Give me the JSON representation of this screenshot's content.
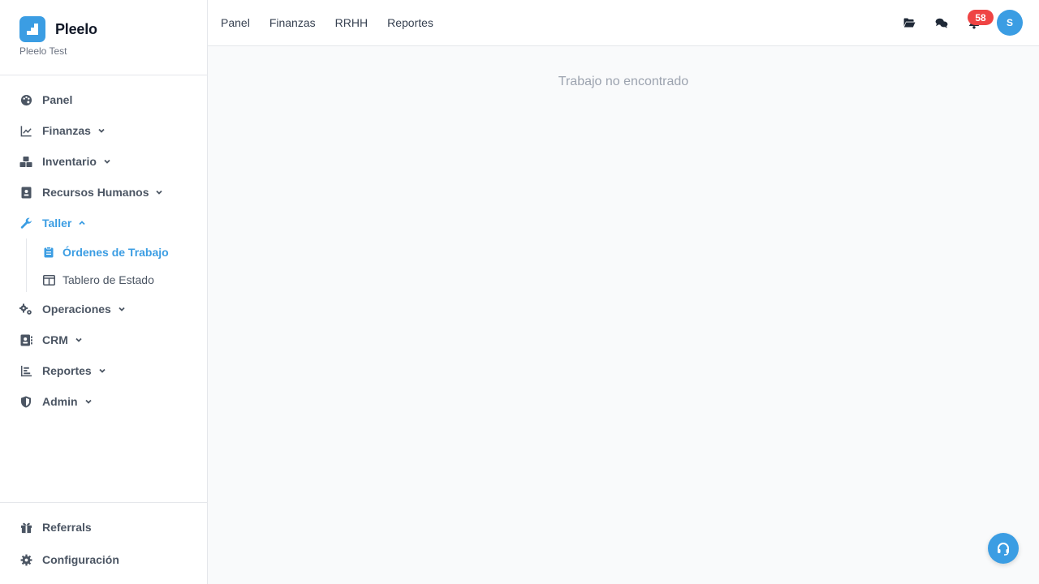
{
  "brand": {
    "name": "Pleelo",
    "subtitle": "Pleelo Test",
    "color": "#3b9de3"
  },
  "sidebar": {
    "items": [
      {
        "label": "Panel",
        "icon": "palette-icon"
      },
      {
        "label": "Finanzas",
        "icon": "chart-line-icon",
        "expandable": true
      },
      {
        "label": "Inventario",
        "icon": "boxes-icon",
        "expandable": true
      },
      {
        "label": "Recursos Humanos",
        "icon": "id-badge-icon",
        "expandable": true
      },
      {
        "label": "Taller",
        "icon": "wrench-icon",
        "expandable": true,
        "expanded": true,
        "active": true
      },
      {
        "label": "Operaciones",
        "icon": "cogs-icon",
        "expandable": true
      },
      {
        "label": "CRM",
        "icon": "address-book-icon",
        "expandable": true
      },
      {
        "label": "Reportes",
        "icon": "chart-bar-icon",
        "expandable": true
      },
      {
        "label": "Admin",
        "icon": "shield-icon",
        "expandable": true
      }
    ],
    "taller_subitems": [
      {
        "label": "Órdenes de Trabajo",
        "icon": "clipboard-icon",
        "active": true
      },
      {
        "label": "Tablero de Estado",
        "icon": "columns-icon"
      }
    ],
    "footer": [
      {
        "label": "Referrals",
        "icon": "gift-icon"
      },
      {
        "label": "Configuración",
        "icon": "gear-icon"
      }
    ]
  },
  "topbar": {
    "nav": [
      "Panel",
      "Finanzas",
      "RRHH",
      "Reportes"
    ],
    "notification_count": "58",
    "avatar_initial": "S"
  },
  "main": {
    "message": "Trabajo no encontrado"
  },
  "colors": {
    "accent": "#3b9de3",
    "badge": "#ef4444",
    "text": "#4b5563"
  }
}
